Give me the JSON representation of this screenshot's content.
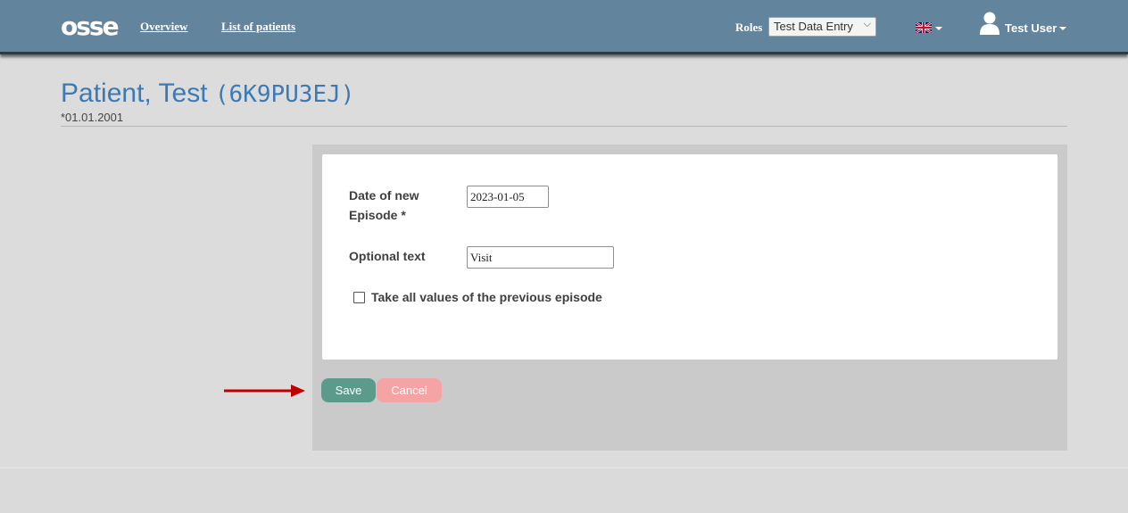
{
  "nav": {
    "logo": "osse",
    "links": [
      "Overview",
      "List of patients"
    ],
    "roles_label": "Roles",
    "role_selected": "Test Data Entry",
    "language_icon": "uk-flag-icon",
    "user_name": "Test User"
  },
  "patient": {
    "name": "Patient, Test",
    "id": "(6K9PU3EJ)",
    "dob": "*01.01.2001"
  },
  "form": {
    "date_label": "Date of new Episode *",
    "date_value": "2023-01-05",
    "text_label": "Optional text",
    "text_value": "Visit",
    "checkbox_label": "Take all values of the previous episode",
    "checkbox_checked": false
  },
  "buttons": {
    "save": "Save",
    "cancel": "Cancel"
  },
  "colors": {
    "navbar": "#63849d",
    "title": "#3b7ab6",
    "save": "#5c9a8b",
    "cancel": "#f4a4a4",
    "arrow": "#c00000"
  }
}
